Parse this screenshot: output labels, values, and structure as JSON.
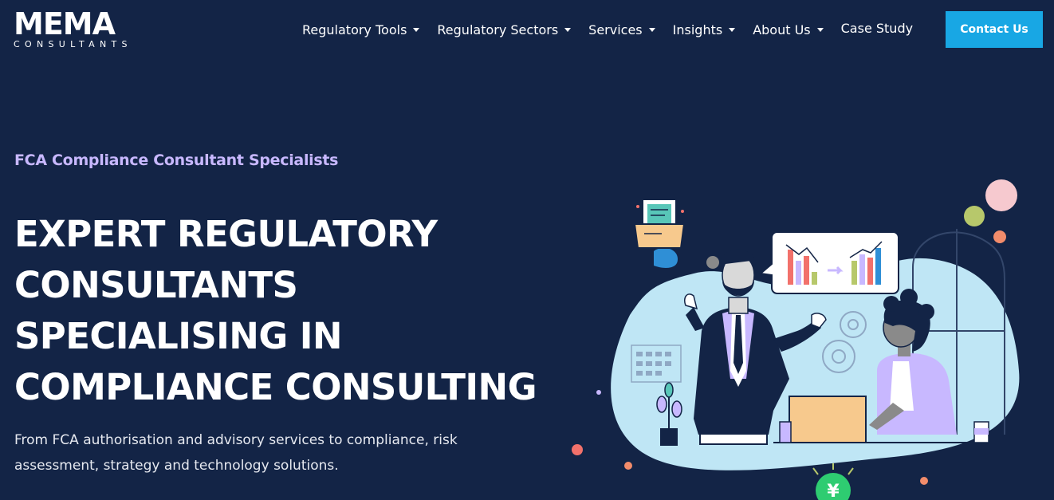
{
  "brand": {
    "logo_mark": "MEMA",
    "logo_sub": "CONSULTANTS"
  },
  "nav": {
    "items": [
      {
        "label": "Regulatory Tools",
        "has_dropdown": true
      },
      {
        "label": "Regulatory Sectors",
        "has_dropdown": true
      },
      {
        "label": "Services",
        "has_dropdown": true
      },
      {
        "label": "Insights",
        "has_dropdown": true
      },
      {
        "label": "About Us",
        "has_dropdown": true
      },
      {
        "label": "Case Study",
        "has_dropdown": false
      }
    ],
    "cta_label": "Contact Us"
  },
  "hero": {
    "eyebrow": "FCA Compliance Consultant Specialists",
    "title_lines": [
      "EXPERT REGULATORY",
      "CONSULTANTS",
      "SPECIALISING IN",
      "COMPLIANCE CONSULTING"
    ],
    "subtitle_lines": [
      "From FCA authorisation and advisory services to compliance, risk",
      "assessment, strategy and technology solutions."
    ]
  },
  "illustration": {
    "currency_symbol": "¥"
  },
  "colors": {
    "background": "#132446",
    "accent": "#18a7e4",
    "eyebrow": "#c8b8ff",
    "blob": "#bfe6f5"
  }
}
